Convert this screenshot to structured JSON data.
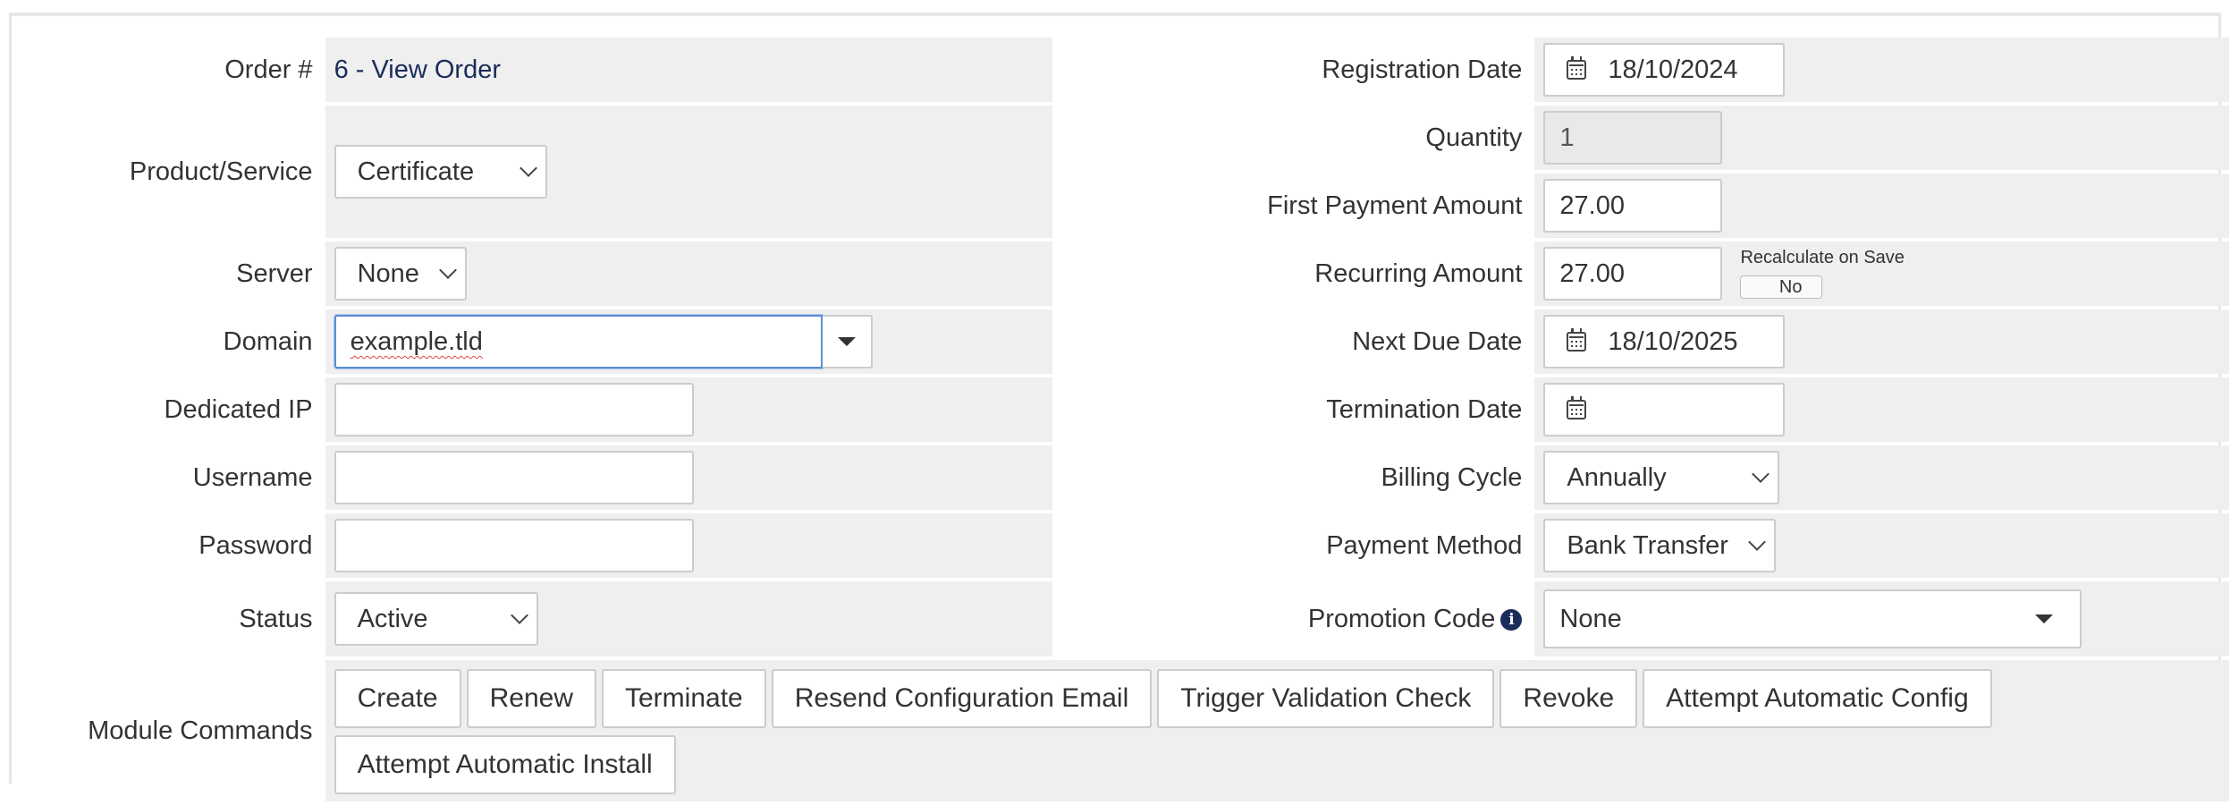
{
  "left": {
    "order": {
      "label": "Order #",
      "value": "6 - View Order"
    },
    "product": {
      "label": "Product/Service",
      "value": "Certificate"
    },
    "server": {
      "label": "Server",
      "value": "None"
    },
    "domain": {
      "label": "Domain",
      "value": "example.tld"
    },
    "dedicated_ip": {
      "label": "Dedicated IP",
      "value": ""
    },
    "username": {
      "label": "Username",
      "value": ""
    },
    "password": {
      "label": "Password",
      "value": ""
    },
    "status": {
      "label": "Status",
      "value": "Active"
    }
  },
  "right": {
    "registration_date": {
      "label": "Registration Date",
      "value": "18/10/2024"
    },
    "quantity": {
      "label": "Quantity",
      "value": "1"
    },
    "first_payment": {
      "label": "First Payment Amount",
      "value": "27.00"
    },
    "recurring": {
      "label": "Recurring Amount",
      "value": "27.00",
      "recalc_label": "Recalculate on Save",
      "recalc_value": "No"
    },
    "next_due": {
      "label": "Next Due Date",
      "value": "18/10/2025"
    },
    "termination": {
      "label": "Termination Date",
      "value": ""
    },
    "billing_cycle": {
      "label": "Billing Cycle",
      "value": "Annually"
    },
    "payment_method": {
      "label": "Payment Method",
      "value": "Bank Transfer"
    },
    "promotion": {
      "label": "Promotion Code",
      "value": "None",
      "info_icon": "i"
    }
  },
  "module_commands": {
    "label": "Module Commands",
    "buttons": [
      "Create",
      "Renew",
      "Terminate",
      "Resend Configuration Email",
      "Trigger Validation Check",
      "Revoke",
      "Attempt Automatic Config",
      "Attempt Automatic Install"
    ]
  },
  "colors": {
    "field_bg": "#efefef",
    "link_text": "#1a2c5a",
    "info_icon": "#1a2c5a",
    "focus_border": "#5b8fd6"
  }
}
